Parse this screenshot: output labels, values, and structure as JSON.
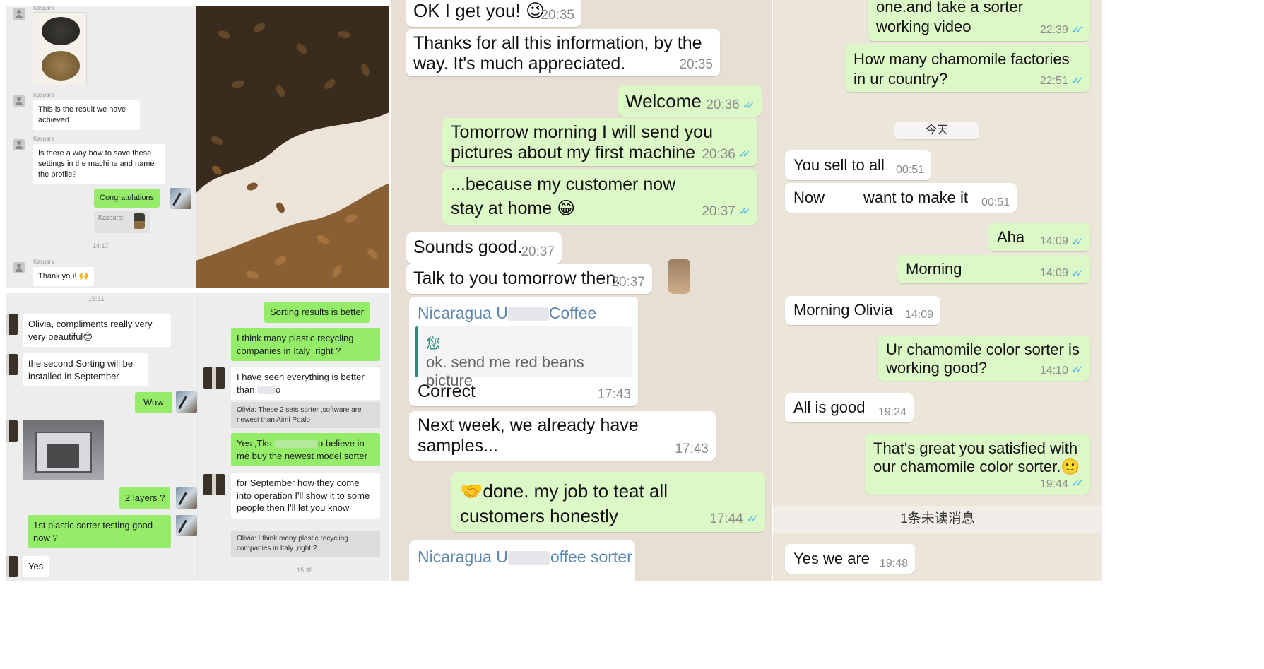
{
  "panel_a": {
    "sender": "Kaspars",
    "msg_result": "This is the result we have achieved",
    "msg_save": "Is there a way how to save these settings in the machine and name the profile?",
    "msg_congrats": "Congratulations",
    "quote_name": "Kaspars:",
    "time_1": "14:17",
    "msg_thanks": "Thank you! 🙌"
  },
  "panel_b": {
    "time_top": "15:31",
    "msg_compliment": "Olivia, compliments really very very beautiful😊",
    "msg_second": "the second Sorting will be installed in September",
    "msg_wow": "Wow",
    "msg_layers": "2 layers ?",
    "msg_first_plastic": "1st plastic sorter testing good now ?",
    "msg_yes": "Yes",
    "msg_sorting_results": "Sorting results is better",
    "msg_plastic_italy": "I think many plastic recycling companies in Italy ,right ?",
    "msg_seen_a": "I have seen everything is better than",
    "msg_seen_b": "o",
    "quote_sets": "Olivia: These 2 sets sorter ,software are newest than Aimi Poalo",
    "msg_tks_a": "Yes ,Tks",
    "msg_tks_b": "o believe in me buy the newest model sorter",
    "msg_september": "for September how they come into operation I'll show it to some people then I'll let you know",
    "quote_plastic": "Olivia: I think many plastic recycling companies in Italy ,right ?",
    "time_bottom": "15:39"
  },
  "panel_c": {
    "top_text": "OK I get you! 😉",
    "top_time": "20:35",
    "msg_thanks": "Thanks for all this information, by the way. It's much appreciated.",
    "msg_thanks_time": "20:35",
    "msg_welcome": "Welcome",
    "msg_welcome_time": "20:36",
    "msg_tomorrow": "Tomorrow morning I will send you pictures about my first machine",
    "msg_tomorrow_time": "20:36",
    "msg_because": "...because my customer now stay at home 😁",
    "msg_because_time": "20:37",
    "msg_sounds": "Sounds good.",
    "msg_sounds_time": "20:37",
    "msg_talk": "Talk to you tomorrow then.",
    "msg_talk_time": "20:37",
    "reply_sender_a": "Nicaragua U",
    "reply_sender_b": "Coffee sorter",
    "reply_quote_line1": "您",
    "reply_quote_line2": "ok. send me red beans picture",
    "msg_correct": "Correct",
    "msg_correct_time": "17:43",
    "msg_nextweek": "Next week, we already have samples...",
    "msg_nextweek_time": "17:43",
    "msg_done": "🤝done. my job to teat all customers honestly",
    "msg_done_time": "17:44",
    "bottom_sender_a": "Nicaragua U",
    "bottom_sender_b": "offee sorter"
  },
  "panel_d": {
    "top_text": "one.and take a sorter working video",
    "top_time": "22:39",
    "msg_factories": "How many chamomile factories in ur country?",
    "msg_factories_time": "22:51",
    "date_today": "今天",
    "msg_sell": "You sell to all",
    "msg_sell_time": "00:51",
    "msg_now_a": "Now",
    "msg_now_b": "want to make it",
    "msg_now_time": "00:51",
    "msg_aha": "Aha",
    "msg_aha_time": "14:09",
    "msg_morning": "Morning",
    "msg_morning_time": "14:09",
    "msg_morning_olivia": "Morning Olivia",
    "msg_morning_olivia_time": "14:09",
    "msg_chamomile": "Ur chamomile color sorter is working good?",
    "msg_chamomile_time": "14:10",
    "msg_allgood": "All is good",
    "msg_allgood_time": "19:24",
    "msg_great": "That's great you satisfied with our chamomile color sorter.🙂",
    "msg_great_time": "19:44",
    "unread": "1条未读消息",
    "msg_yes": "Yes we are",
    "msg_yes_time": "19:48"
  }
}
